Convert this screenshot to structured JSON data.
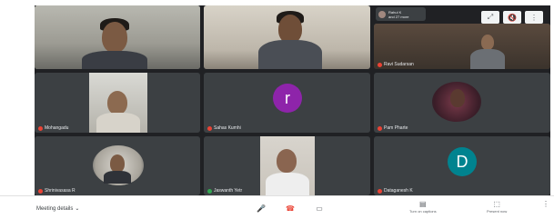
{
  "meeting": {
    "details_label": "Meeting details",
    "controls": {
      "mic_icon": "mic-icon",
      "hangup_icon": "phone-hangup-icon",
      "camera_icon": "camera-icon",
      "captions_label": "Turn on captions",
      "present_label": "Present now"
    }
  },
  "presenter_badge": {
    "line1": "Rahul K",
    "line2": "and 27 more"
  },
  "participants": [
    {
      "name": "",
      "type": "video"
    },
    {
      "name": "",
      "type": "video"
    },
    {
      "name": "Ravi Sudarsan",
      "type": "video"
    },
    {
      "name": "Mohangadu",
      "type": "video"
    },
    {
      "name": "Sahas Kumhi",
      "type": "avatar",
      "initial": "r",
      "color": "#8e24aa"
    },
    {
      "name": "Pam Pharte",
      "type": "video"
    },
    {
      "name": "Shrinivasasa R",
      "type": "video"
    },
    {
      "name": "Jaswanth Yetr",
      "type": "video"
    },
    {
      "name": "Dataganesh K",
      "type": "avatar",
      "initial": "D",
      "color": "#00838f"
    }
  ],
  "colors": {
    "stage_bg": "#202124",
    "tile_bg": "#3c4043",
    "mic_off": "#ea4335",
    "hangup": "#ea4335"
  }
}
